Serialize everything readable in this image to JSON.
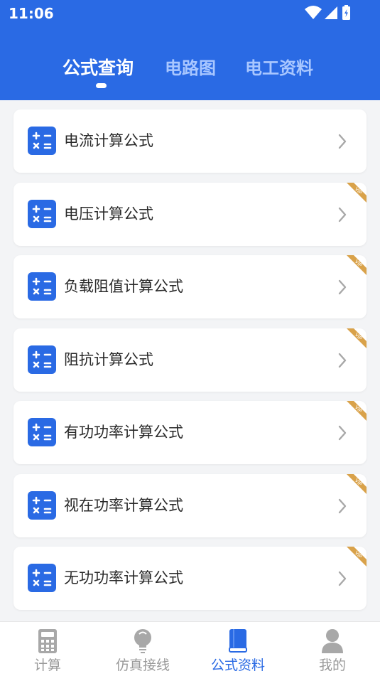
{
  "status_bar": {
    "time": "11:06",
    "icons": [
      "wifi-icon",
      "signal-icon",
      "battery-charging-icon"
    ]
  },
  "top_tabs": [
    {
      "label": "公式查询",
      "active": true
    },
    {
      "label": "电路图",
      "active": false
    },
    {
      "label": "电工资料",
      "active": false
    }
  ],
  "formulas": [
    {
      "label": "电流计算公式",
      "vip": false
    },
    {
      "label": "电压计算公式",
      "vip": true
    },
    {
      "label": "负载阻值计算公式",
      "vip": true
    },
    {
      "label": "阻抗计算公式",
      "vip": true
    },
    {
      "label": "有功功率计算公式",
      "vip": true
    },
    {
      "label": "视在功率计算公式",
      "vip": true
    },
    {
      "label": "无功功率计算公式",
      "vip": true
    }
  ],
  "vip_badge": "VIP",
  "bottom_nav": [
    {
      "label": "计算",
      "icon": "calculator-icon",
      "active": false
    },
    {
      "label": "仿真接线",
      "icon": "lightbulb-icon",
      "active": false
    },
    {
      "label": "公式资料",
      "icon": "book-icon",
      "active": true
    },
    {
      "label": "我的",
      "icon": "person-icon",
      "active": false
    }
  ],
  "colors": {
    "primary": "#2a6ae4",
    "tab_inactive": "#a9c7ff",
    "vip_gold": "#d9a24a",
    "nav_inactive": "#9a9a9a",
    "background": "#f3f4f6"
  }
}
